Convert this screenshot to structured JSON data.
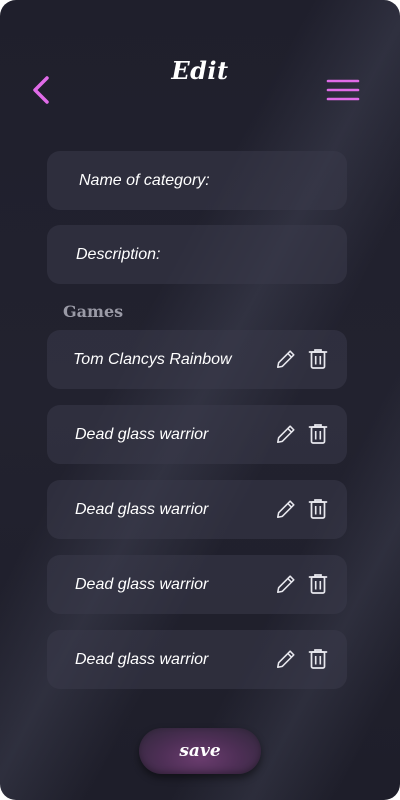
{
  "header": {
    "title": "Edit",
    "back_icon": "chevron-left-icon",
    "menu_icon": "hamburger-menu-icon"
  },
  "form": {
    "name_label": "Name of category:",
    "description_label": "Description:"
  },
  "games": {
    "section_label": "Games",
    "items": [
      {
        "name": "Tom Clancys Rainbow"
      },
      {
        "name": "Dead glass warrior"
      },
      {
        "name": "Dead glass warrior"
      },
      {
        "name": "Dead glass warrior"
      },
      {
        "name": "Dead glass warrior"
      }
    ],
    "edit_icon": "pencil-icon",
    "delete_icon": "trash-icon"
  },
  "footer": {
    "save_label": "save"
  },
  "colors": {
    "background": "#20202d",
    "card": "#33333f",
    "accent": "#e06be8",
    "text": "#ffffff",
    "muted": "#9a9aa6",
    "save_button": "#5a3362"
  }
}
